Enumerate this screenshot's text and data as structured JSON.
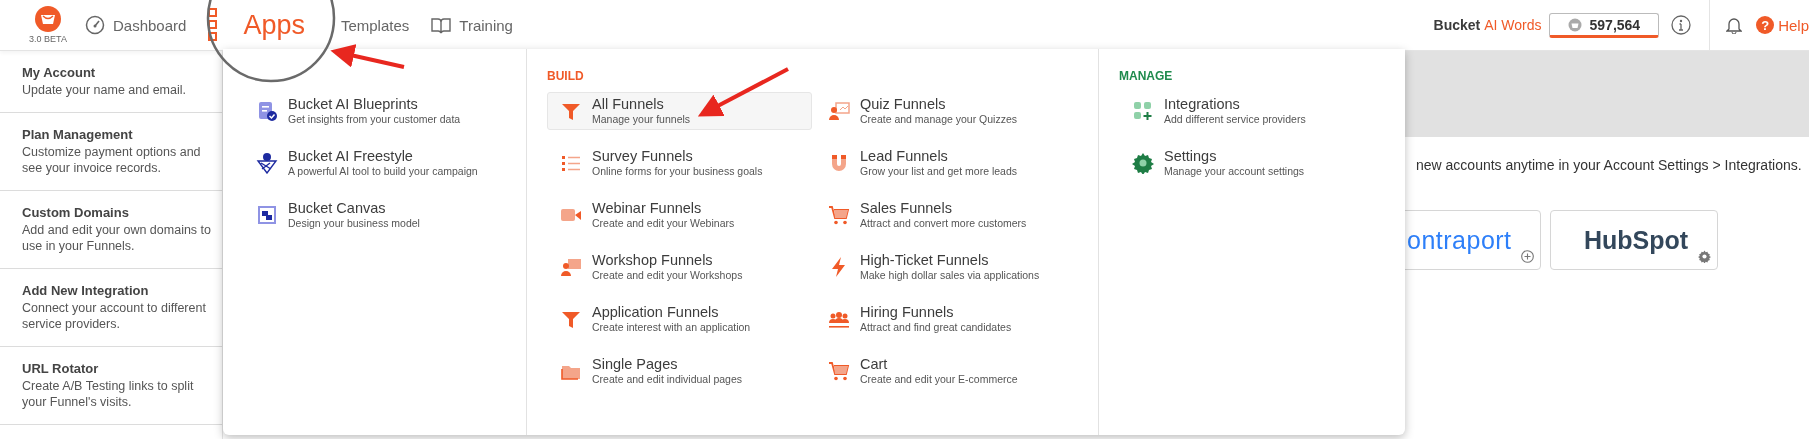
{
  "header": {
    "logo": {
      "badge": "3.0 BETA"
    },
    "nav": [
      {
        "label": "Dashboard",
        "selected": false
      },
      {
        "label": "Apps",
        "selected": true
      },
      {
        "label": "Templates",
        "selected": false
      },
      {
        "label": "Training",
        "selected": false
      }
    ],
    "words": {
      "brand": "Bucket",
      "label": "AI Words",
      "count": "597,564"
    },
    "help": {
      "glyph": "?",
      "label": "Help"
    }
  },
  "sidebar": {
    "items": [
      {
        "title": "My Account",
        "text": "Update your name and email."
      },
      {
        "title": "Plan Management",
        "text": "Customize payment options and see your invoice records."
      },
      {
        "title": "Custom Domains",
        "text": "Add and edit your own domains to use in your Funnels."
      },
      {
        "title": "Add New Integration",
        "text": "Connect your account to different service providers."
      },
      {
        "title": "URL Rotator",
        "text": "Create A/B Testing links to split your Funnel's visits."
      }
    ]
  },
  "menu": {
    "sections": [
      {
        "items": [
          {
            "title": "Bucket AI Blueprints",
            "subtitle": "Get insights from your customer data",
            "selected": false
          },
          {
            "title": "Bucket AI Freestyle",
            "subtitle": "A powerful AI tool to build your campaign",
            "selected": false
          },
          {
            "title": "Bucket Canvas",
            "subtitle": "Design your business model",
            "selected": false
          }
        ]
      },
      {
        "heading": "BUILD",
        "color": "#f05a28",
        "items": [
          {
            "title": "All Funnels",
            "subtitle": "Manage your funnels",
            "selected": true
          },
          {
            "title": "Quiz Funnels",
            "subtitle": "Create and manage your Quizzes",
            "selected": false
          },
          {
            "title": "Survey Funnels",
            "subtitle": "Online forms for your business goals",
            "selected": false
          },
          {
            "title": "Lead Funnels",
            "subtitle": "Grow your list and get more leads",
            "selected": false
          },
          {
            "title": "Webinar Funnels",
            "subtitle": "Create and edit your Webinars",
            "selected": false
          },
          {
            "title": "Sales Funnels",
            "subtitle": "Attract and convert more customers",
            "selected": false
          },
          {
            "title": "Workshop Funnels",
            "subtitle": "Create and edit your Workshops",
            "selected": false
          },
          {
            "title": "High-Ticket Funnels",
            "subtitle": "Make high dollar sales via applications",
            "selected": false
          },
          {
            "title": "Application Funnels",
            "subtitle": "Create interest with an application",
            "selected": false
          },
          {
            "title": "Hiring Funnels",
            "subtitle": "Attract and find great candidates",
            "selected": false
          },
          {
            "title": "Single Pages",
            "subtitle": "Create and edit individual pages",
            "selected": false
          },
          {
            "title": "Cart",
            "subtitle": "Create and edit your E-commerce",
            "selected": false
          }
        ]
      },
      {
        "heading": "MANAGE",
        "color": "#1e8a4c",
        "items": [
          {
            "title": "Integrations",
            "subtitle": "Add different service providers",
            "selected": false
          },
          {
            "title": "Settings",
            "subtitle": "Manage your account settings",
            "selected": false
          }
        ]
      }
    ]
  },
  "content": {
    "note": "new accounts anytime in your Account Settings > Integrations.",
    "integrations": [
      {
        "name": "ontraport",
        "color": "#2d7ff9",
        "kind": "add"
      },
      {
        "name": "HubSpot",
        "color": "#33475b",
        "kind": "settings"
      }
    ]
  }
}
